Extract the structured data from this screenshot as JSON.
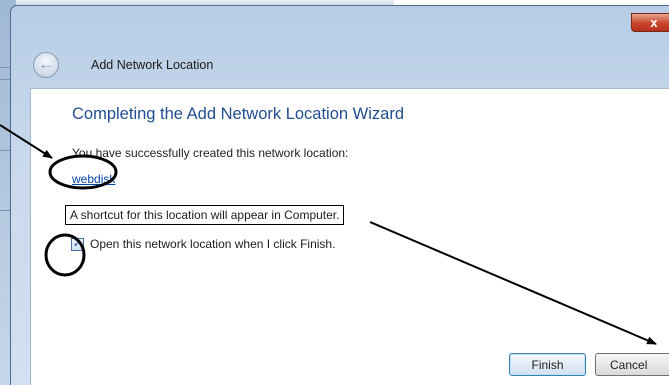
{
  "window": {
    "close_glyph": "x",
    "back_glyph": "←",
    "title": "Add Network Location"
  },
  "content": {
    "heading": "Completing the Add Network Location Wizard",
    "success_text": "You have successfully created this network location:",
    "location_name": "webdisk",
    "shortcut_text": "A shortcut for this location will appear in Computer.",
    "open_checkbox": {
      "checked": true,
      "check_glyph": "✓",
      "label": "Open this network location when I click Finish."
    }
  },
  "footer": {
    "finish_label": "Finish",
    "cancel_label": "Cancel"
  },
  "colors": {
    "heading": "#1f4d8f",
    "link": "#0645ad",
    "close_button": "#c8442a",
    "annotation": "#000000"
  }
}
